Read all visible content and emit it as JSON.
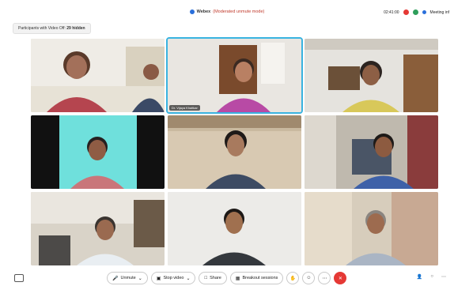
{
  "meeting": {
    "app": "Webex",
    "mode": "(Moderated unmute mode)",
    "timer": "02:41:00",
    "info_label": "Meeting inf"
  },
  "participants_pill": {
    "label": "Participants with Video Off:",
    "count": "29 hidden"
  },
  "tiles": [
    {
      "label": ""
    },
    {
      "label": "Dr. Vijaya Khaitkar"
    },
    {
      "label": ""
    },
    {
      "label": ""
    },
    {
      "label": ""
    },
    {
      "label": ""
    },
    {
      "label": ""
    },
    {
      "label": ""
    },
    {
      "label": ""
    }
  ],
  "controls": {
    "unmute": "Unmute",
    "stop_video": "Stop video",
    "share": "Share",
    "breakout": "Breakout sessions"
  },
  "colors": {
    "accent": "#39b3e0",
    "end_call": "#e53935"
  }
}
